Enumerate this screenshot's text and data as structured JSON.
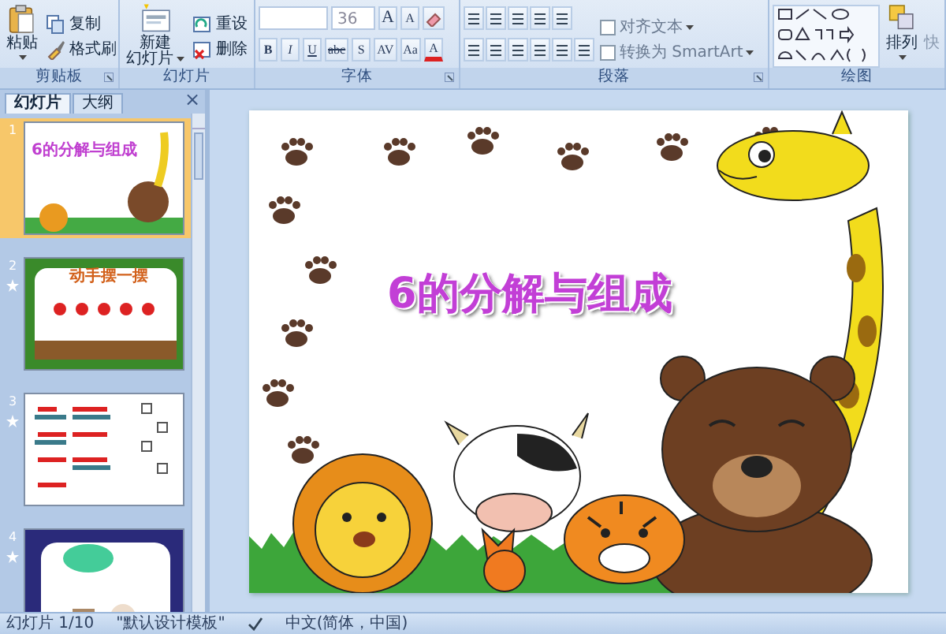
{
  "ribbon": {
    "groups": [
      {
        "kind": "buttons",
        "label": "剪贴板",
        "launcher": true,
        "large": {
          "label_lines": [
            "粘贴"
          ],
          "dropdown": true
        },
        "small": [
          "复制",
          "格式刷"
        ]
      },
      {
        "kind": "buttons",
        "label": "幻灯片",
        "launcher": false,
        "large": {
          "label_lines": [
            "新建",
            "幻灯片"
          ],
          "dropdown": true
        },
        "small": [
          "重设",
          "删除"
        ]
      },
      {
        "kind": "font",
        "label": "字体",
        "launcher": true,
        "font_size": "36",
        "size_buttons": [
          "A",
          "A"
        ],
        "format_buttons": [
          "B",
          "I",
          "U",
          "abc",
          "S",
          "AV",
          "Aa",
          "A"
        ]
      },
      {
        "kind": "paragraph",
        "label": "段落",
        "launcher": true,
        "text_buttons": [
          "对齐文本",
          "转换为 SmartArt"
        ]
      },
      {
        "kind": "drawing",
        "label": "绘图",
        "launcher": false,
        "large": {
          "label_lines": [
            "排列"
          ],
          "dropdown": true
        },
        "cut_label": "快"
      }
    ]
  },
  "pane": {
    "tabs": [
      {
        "label": "幻灯片",
        "selected": true
      },
      {
        "label": "大纲",
        "selected": false
      }
    ],
    "close": "×",
    "slides": [
      {
        "number": "1",
        "selected": true,
        "animated": false,
        "title": "6的分解与组成"
      },
      {
        "number": "2",
        "selected": false,
        "animated": true,
        "title": "动手摆一摆"
      },
      {
        "number": "3",
        "selected": false,
        "animated": true
      },
      {
        "number": "4",
        "selected": false,
        "animated": true
      }
    ]
  },
  "slide": {
    "title": "6的分解与组成"
  },
  "status_bar": {
    "slide": "幻灯片 1/10",
    "theme": "\"默认设计模板\"",
    "language": "中文(简体，中国)"
  }
}
